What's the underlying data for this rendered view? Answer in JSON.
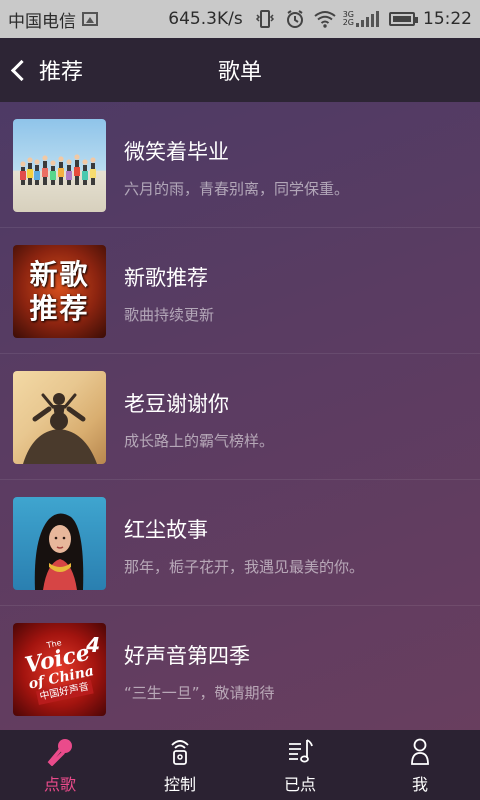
{
  "status_bar": {
    "carrier": "中国电信",
    "speed": "645.3K/s",
    "network": [
      "3G",
      "2G"
    ],
    "time": "15:22"
  },
  "nav": {
    "back_label": "推荐",
    "title": "歌单"
  },
  "playlists": [
    {
      "title": "微笑着毕业",
      "desc": "六月的雨，青春别离，同学保重。"
    },
    {
      "title": "新歌推荐",
      "desc": "歌曲持续更新",
      "cover_text": [
        "新歌",
        "推荐"
      ]
    },
    {
      "title": "老豆谢谢你",
      "desc": "成长路上的霸气榜样。"
    },
    {
      "title": "红尘故事",
      "desc": "那年，栀子花开，我遇见最美的你。"
    },
    {
      "title": "好声音第四季",
      "desc": "“三生一旦”，敬请期待",
      "cover_text": [
        "The",
        "Voice",
        "of China",
        "中国好声音",
        "4"
      ]
    }
  ],
  "tabs": [
    {
      "label": "点歌",
      "icon": "microphone-icon",
      "active": true
    },
    {
      "label": "控制",
      "icon": "remote-control-icon",
      "active": false
    },
    {
      "label": "已点",
      "icon": "playlist-icon",
      "active": false
    },
    {
      "label": "我",
      "icon": "user-icon",
      "active": false
    }
  ],
  "colors": {
    "accent": "#ea4b8b",
    "nav_bg": "#2d2535",
    "tab_bg": "#2b2232",
    "status_bg": "#c9c9c9"
  }
}
